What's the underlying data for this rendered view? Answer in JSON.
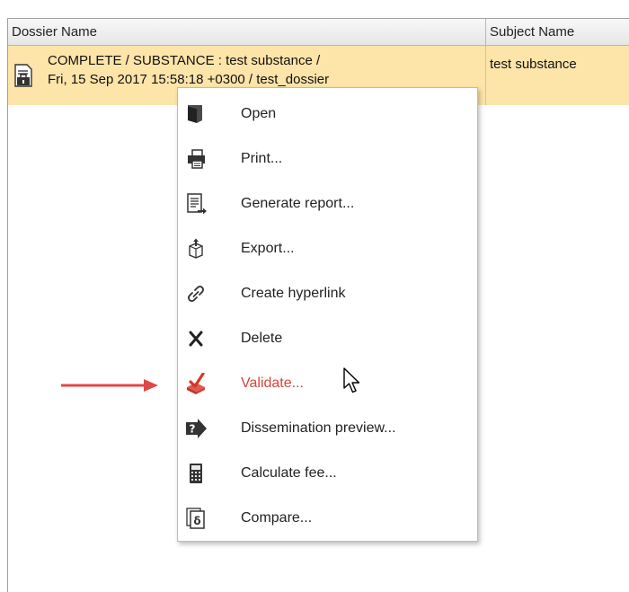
{
  "table": {
    "columns": [
      "Dossier Name",
      "Subject Name"
    ],
    "row": {
      "dossier_line1": "COMPLETE / SUBSTANCE : test substance /",
      "dossier_line2": "Fri, 15 Sep 2017 15:58:18 +0300 / test_dossier",
      "subject": "test substance",
      "icon": "locked-dossier-icon",
      "selected_color": "#fde4a9"
    }
  },
  "context_menu": {
    "items": [
      {
        "label": "Open",
        "icon": "open-icon"
      },
      {
        "label": "Print...",
        "icon": "printer-icon"
      },
      {
        "label": "Generate report...",
        "icon": "report-icon"
      },
      {
        "label": "Export...",
        "icon": "export-icon"
      },
      {
        "label": "Create hyperlink",
        "icon": "link-icon"
      },
      {
        "label": "Delete",
        "icon": "delete-icon"
      },
      {
        "label": "Validate...",
        "icon": "validate-icon",
        "highlighted": true,
        "highlight_color": "#d9443a"
      },
      {
        "label": "Dissemination preview...",
        "icon": "dissemination-preview-icon"
      },
      {
        "label": "Calculate fee...",
        "icon": "calculator-icon"
      },
      {
        "label": "Compare...",
        "icon": "compare-icon"
      }
    ]
  },
  "annotation": {
    "arrow_color": "#e04848"
  }
}
